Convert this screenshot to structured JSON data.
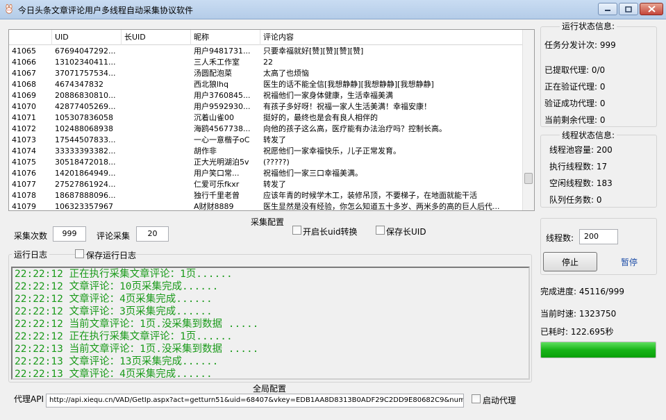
{
  "window": {
    "title": "今日头条文章评论用户多线程自动采集协议软件"
  },
  "table": {
    "headers": [
      "",
      "UID",
      "长UID",
      "昵称",
      "评论内容"
    ],
    "rows": [
      [
        "41065",
        "67694047292...",
        "",
        "用户9481731...",
        "只要幸福就好[赞][赞][赞][赞]"
      ],
      [
        "41066",
        "13102340411...",
        "",
        "三人禾工作室",
        "22"
      ],
      [
        "41067",
        "37071757534...",
        "",
        "汤圆配泡菜",
        "太高了也烦恼"
      ],
      [
        "41068",
        "4674347832",
        "",
        "西北狼lhq",
        "医生的话不能全信[我想静静][我想静静][我想静静]"
      ],
      [
        "41069",
        "20886830810...",
        "",
        "用户3760845...",
        "祝福他们一家身体健康，生活幸福美满"
      ],
      [
        "41070",
        "42877405269...",
        "",
        "用户9592930...",
        "有孩子多好呀！祝福一家人生活美满！幸福安康！"
      ],
      [
        "41071",
        "105307836058",
        "",
        "沉着山雀00",
        "挺好的，最终也是会有良人相伴的"
      ],
      [
        "41072",
        "102488068938",
        "",
        "海鸥4567738...",
        "向他的孩子这么高，医疗能有办法治疗吗？控制长高。"
      ],
      [
        "41073",
        "17544507833...",
        "",
        "一心一意楷子oC",
        "转发了"
      ],
      [
        "41074",
        "33333393382...",
        "",
        "胡作非",
        "祝愿他们一家幸福快乐，儿子正常发育。"
      ],
      [
        "41075",
        "30518472018...",
        "",
        "正大光明湖泊5v",
        "(?????)"
      ],
      [
        "41076",
        "14201864949...",
        "",
        "用户笑口常...",
        "祝福他们一家三口幸福美满。"
      ],
      [
        "41077",
        "27527861924...",
        "",
        "仁爱可乐fkxr",
        "转发了"
      ],
      [
        "41078",
        "18687888096...",
        "",
        "独行千里老曾",
        "应该年青的时候学木工，装修吊顶，不要梯子，在地面就能干活"
      ],
      [
        "41079",
        "106323357967",
        "",
        "A财财8889",
        "医生显然是没有经验，你怎么知道五十多岁、两米多的高的巨人后代..."
      ]
    ]
  },
  "collect": {
    "title": "采集配置",
    "count_label": "采集次数",
    "count_value": "999",
    "comment_label": "评论采集",
    "comment_value": "20",
    "long_uid_label": "开启长uid转换",
    "save_long_uid_label": "保存长UID"
  },
  "log": {
    "title": "运行日志",
    "save_label": "保存运行日志",
    "lines": [
      "22:22:12 正在执行采集文章评论：1页......",
      "22:22:12 文章评论：10页采集完成......",
      "22:22:12 文章评论：4页采集完成......",
      "22:22:12 文章评论：3页采集完成......",
      "22:22:12 当前文章评论：1页.没采集到数据 .....",
      "22:22:12 正在执行采集文章评论：1页......",
      "22:22:13 当前文章评论：1页.没采集到数据 .....",
      "22:22:13 文章评论：13页采集完成......",
      "22:22:13 文章评论：4页采集完成......"
    ]
  },
  "global": {
    "title": "全局配置",
    "api_label": "代理API",
    "api_value": "http://api.xiequ.cn/VAD/GetIp.aspx?act=getturn51&uid=68407&vkey=EDB1AA8D8313B0ADF29C2DD9E80682C9&num",
    "auto_proxy_label": "启动代理"
  },
  "run_status": {
    "title": "运行状态信息:",
    "task_label": "任务分发计次: 999",
    "fetched_label": "已提取代理: 0/0",
    "verifying_label": "正在验证代理: 0",
    "verified_label": "验证成功代理: 0",
    "remaining_label": "当前剩余代理: 0"
  },
  "thread_status": {
    "title": "线程状态信息:",
    "pool_label": "线程池容量: 200",
    "exec_label": "执行线程数: 17",
    "idle_label": "空闲线程数: 183",
    "queue_label": "队列任务数: 0"
  },
  "control": {
    "thread_label": "线程数:",
    "thread_value": "200",
    "stop_label": "停止",
    "pause_label": "暂停"
  },
  "progress": {
    "done_label": "完成进度: 45116/999",
    "speed_label": "当前时速: 1323750",
    "elapsed_label": "已耗时: 122.695秒",
    "fraction": 1.0
  },
  "colors": {
    "log_text": "#1a9a1a",
    "progress": "#18b418",
    "link": "#1f4fa8"
  }
}
